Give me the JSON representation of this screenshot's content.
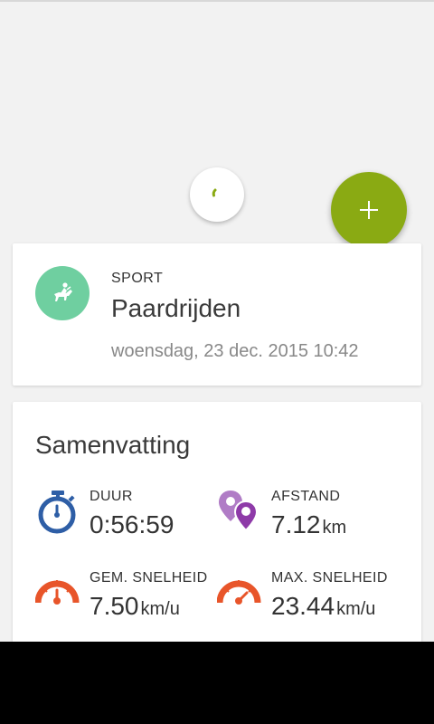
{
  "colors": {
    "fab": "#8aaa13",
    "sport_badge": "#6fcfa0",
    "duration_icon": "#2e5ea6",
    "distance_icon_light": "#b07cc6",
    "distance_icon_dark": "#8e3aa8",
    "speed_icon": "#e8552a"
  },
  "fab": {
    "icon": "plus-icon"
  },
  "sport_card": {
    "label": "SPORT",
    "name": "Paardrijden",
    "icon": "horse-riding-icon",
    "date": "woensdag, 23 dec. 2015 10:42"
  },
  "summary": {
    "title": "Samenvatting",
    "stats": {
      "duration": {
        "label": "DUUR",
        "value": "0:56:59",
        "unit": "",
        "icon": "stopwatch-icon"
      },
      "distance": {
        "label": "AFSTAND",
        "value": "7.12",
        "unit": "km",
        "icon": "map-pin-icon"
      },
      "avg_speed": {
        "label": "GEM. SNELHEID",
        "value": "7.50",
        "unit": "km/u",
        "icon": "speedometer-icon"
      },
      "max_speed": {
        "label": "MAX. SNELHEID",
        "value": "23.44",
        "unit": "km/u",
        "icon": "speedometer-max-icon"
      }
    }
  }
}
